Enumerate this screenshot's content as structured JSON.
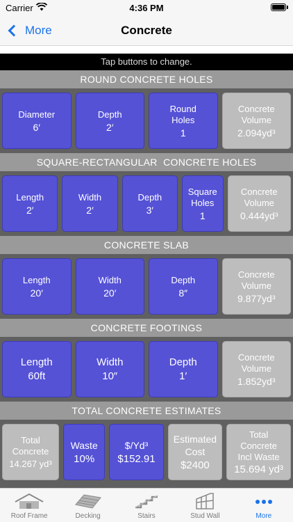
{
  "status": {
    "carrier": "Carrier",
    "time": "4:36 PM"
  },
  "nav": {
    "back_label": "More",
    "title": "Concrete"
  },
  "hint": "Tap buttons to change.",
  "sections": {
    "round": {
      "title": "ROUND CONCRETE HOLES",
      "diameter": {
        "label": "Diameter",
        "value": "6′"
      },
      "depth": {
        "label": "Depth",
        "value": "2′"
      },
      "holes": {
        "label": "Round Holes",
        "value": "1"
      },
      "volume": {
        "label": "Concrete Volume",
        "value": "2.094yd³"
      }
    },
    "square": {
      "title": "SQUARE-RECTANGULAR  CONCRETE HOLES",
      "length": {
        "label": "Length",
        "value": "2′"
      },
      "width": {
        "label": "Width",
        "value": "2′"
      },
      "depth": {
        "label": "Depth",
        "value": "3′"
      },
      "holes": {
        "label": "Square Holes",
        "value": "1"
      },
      "volume": {
        "label": "Concrete Volume",
        "value": "0.444yd³"
      }
    },
    "slab": {
      "title": "CONCRETE SLAB",
      "length": {
        "label": "Length",
        "value": "20′"
      },
      "width": {
        "label": "Width",
        "value": "20′"
      },
      "depth": {
        "label": "Depth",
        "value": "8″"
      },
      "volume": {
        "label": "Concrete Volume",
        "value": "9.877yd³"
      }
    },
    "footings": {
      "title": "CONCRETE FOOTINGS",
      "length": {
        "label": "Length",
        "value": "60ft"
      },
      "width": {
        "label": "Width",
        "value": "10″"
      },
      "depth": {
        "label": "Depth",
        "value": "1′"
      },
      "volume": {
        "label": "Concrete Volume",
        "value": "1.852yd³"
      }
    },
    "totals": {
      "title": "TOTAL CONCRETE ESTIMATES",
      "total": {
        "label": "Total Concrete",
        "value": "14.267 yd³"
      },
      "waste": {
        "label": "Waste",
        "value": "10%"
      },
      "price": {
        "label": "$/Yd³",
        "value": "$152.91"
      },
      "cost": {
        "label": "Estimated Cost",
        "value": "$2400"
      },
      "incl": {
        "label": "Total Concrete Incl Waste",
        "value": "15.694 yd³"
      }
    }
  },
  "tabs": [
    {
      "label": "Roof Frame",
      "icon": "roof-frame-icon"
    },
    {
      "label": "Decking",
      "icon": "decking-icon"
    },
    {
      "label": "Stairs",
      "icon": "stairs-icon"
    },
    {
      "label": "Stud Wall",
      "icon": "stud-wall-icon"
    },
    {
      "label": "More",
      "icon": "more-icon"
    }
  ],
  "colors": {
    "accent": "#1a73e8",
    "tile_blue": "#5552d6",
    "tile_gray": "#bdbdbd",
    "section_header": "#9a9a9a"
  }
}
